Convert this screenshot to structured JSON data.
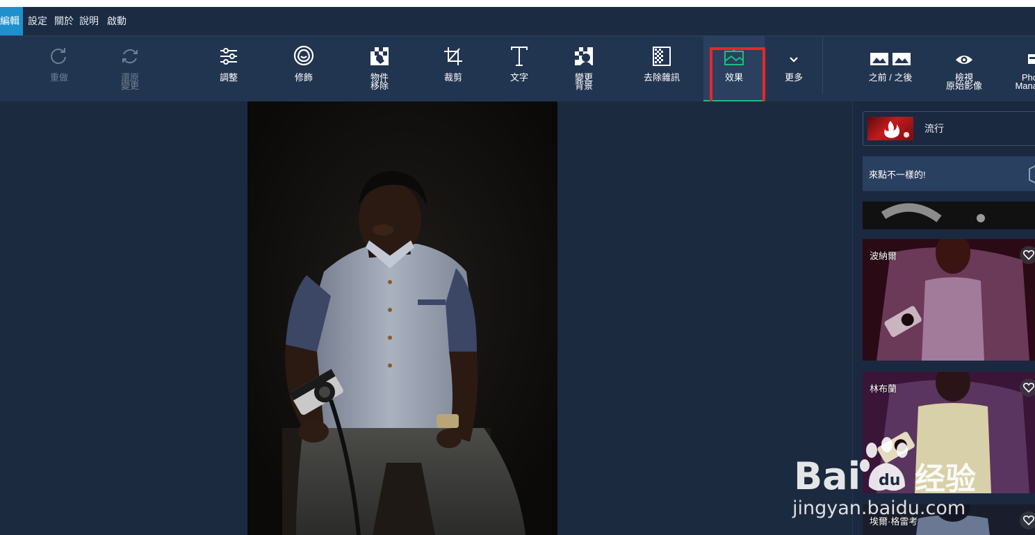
{
  "menu": {
    "items": [
      "編輯",
      "設定",
      "關於",
      "說明",
      "啟動"
    ],
    "active_index": 0
  },
  "toolbar": {
    "redo": {
      "label": "重做",
      "icon": "redo-icon",
      "enabled": false
    },
    "restore": {
      "label": "還原\n變更",
      "icon": "restore-icon",
      "enabled": false
    },
    "adjust": {
      "label": "調整",
      "icon": "sliders-icon"
    },
    "retouch": {
      "label": "修飾",
      "icon": "face-retouch-icon"
    },
    "object_removal": {
      "label": "物件\n移除",
      "icon": "object-removal-icon"
    },
    "crop": {
      "label": "裁剪",
      "icon": "crop-icon"
    },
    "text": {
      "label": "文字",
      "icon": "text-icon"
    },
    "change_background": {
      "label": "變更\n背景",
      "icon": "background-icon"
    },
    "denoise": {
      "label": "去除雜訊",
      "icon": "denoise-icon"
    },
    "effects": {
      "label": "效果",
      "icon": "effects-icon",
      "selected": true
    },
    "more": {
      "label": "更多",
      "icon": "chevron-down-icon"
    },
    "before_after": {
      "label": "之前 / 之後",
      "icon": "before-after-icon"
    },
    "view_original": {
      "label": "檢視\n原始影像",
      "icon": "eye-icon"
    },
    "photo_manager": {
      "label": "Pho\nMana",
      "icon": "photo-manager-icon"
    }
  },
  "side_panel": {
    "category": {
      "label": "流行",
      "icon": "fire-icon"
    },
    "promo_text": "來點不一樣的!",
    "effects": [
      {
        "name": "波納爾",
        "tint": "#7a1530"
      },
      {
        "name": "林布蘭",
        "tint": "#5a1e4a"
      },
      {
        "name": "埃爾·格雷考",
        "tint": "#303a56"
      }
    ]
  },
  "watermark": {
    "logo_text": "Bai经验",
    "url": "jingyan.baidu.com"
  },
  "colors": {
    "accent_green": "#18c27a",
    "highlight_red": "#e8262b",
    "menu_active_blue": "#1f8fce"
  }
}
